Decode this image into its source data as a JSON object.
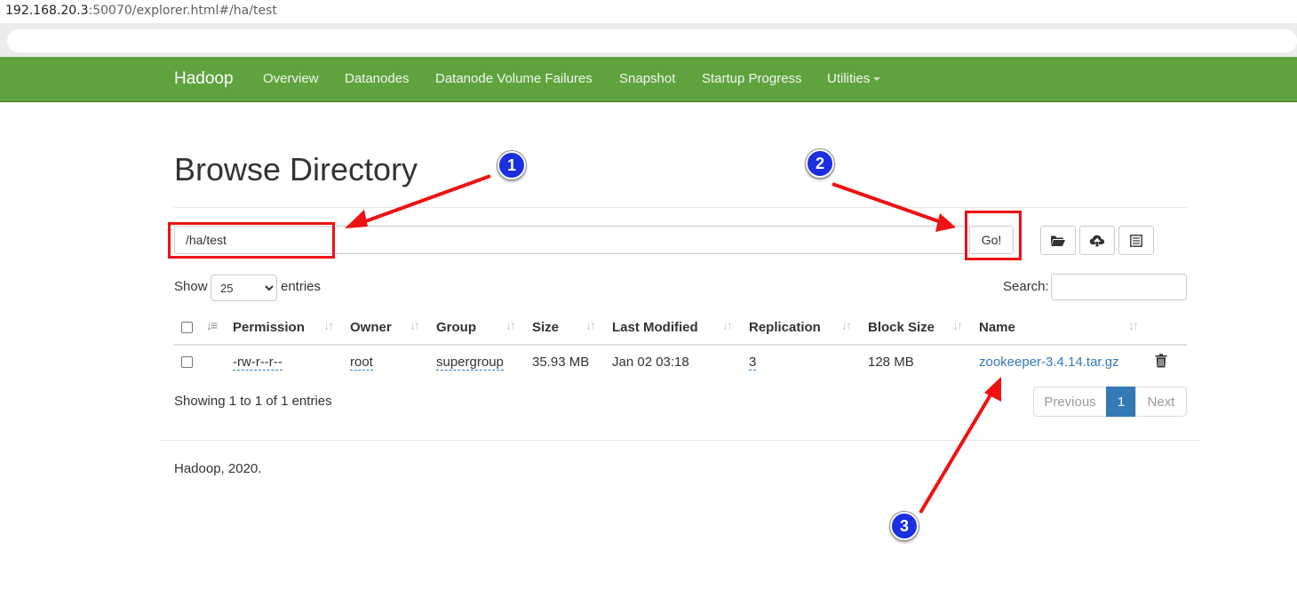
{
  "browser": {
    "url_host": "192.168.20.3",
    "url_rest": ":50070/explorer.html#/ha/test"
  },
  "navbar": {
    "brand": "Hadoop",
    "items": [
      "Overview",
      "Datanodes",
      "Datanode Volume Failures",
      "Snapshot",
      "Startup Progress",
      "Utilities"
    ],
    "bg_color": "#5fa33e"
  },
  "page": {
    "title": "Browse Directory",
    "path_value": "/ha/test",
    "go_label": "Go!",
    "toolbar_icons": [
      "folder-open-icon",
      "cloud-upload-icon",
      "list-alt-icon"
    ]
  },
  "table_controls": {
    "show_label": "Show",
    "entries_value": "25",
    "entries_label": "entries",
    "search_label": "Search:"
  },
  "table": {
    "columns": [
      "Permission",
      "Owner",
      "Group",
      "Size",
      "Last Modified",
      "Replication",
      "Block Size",
      "Name"
    ],
    "rows": [
      {
        "permission": "-rw-r--r--",
        "owner": "root",
        "group": "supergroup",
        "size": "35.93 MB",
        "last_modified": "Jan 02 03:18",
        "replication": "3",
        "block_size": "128 MB",
        "name": "zookeeper-3.4.14.tar.gz"
      }
    ]
  },
  "pagination": {
    "summary": "Showing 1 to 1 of 1 entries",
    "previous": "Previous",
    "current": "1",
    "next": "Next"
  },
  "footer": {
    "text": "Hadoop, 2020."
  },
  "annotations": {
    "badges": [
      "1",
      "2",
      "3"
    ],
    "highlight_color": "#ee1111",
    "badge_color": "#1a2fe0"
  }
}
